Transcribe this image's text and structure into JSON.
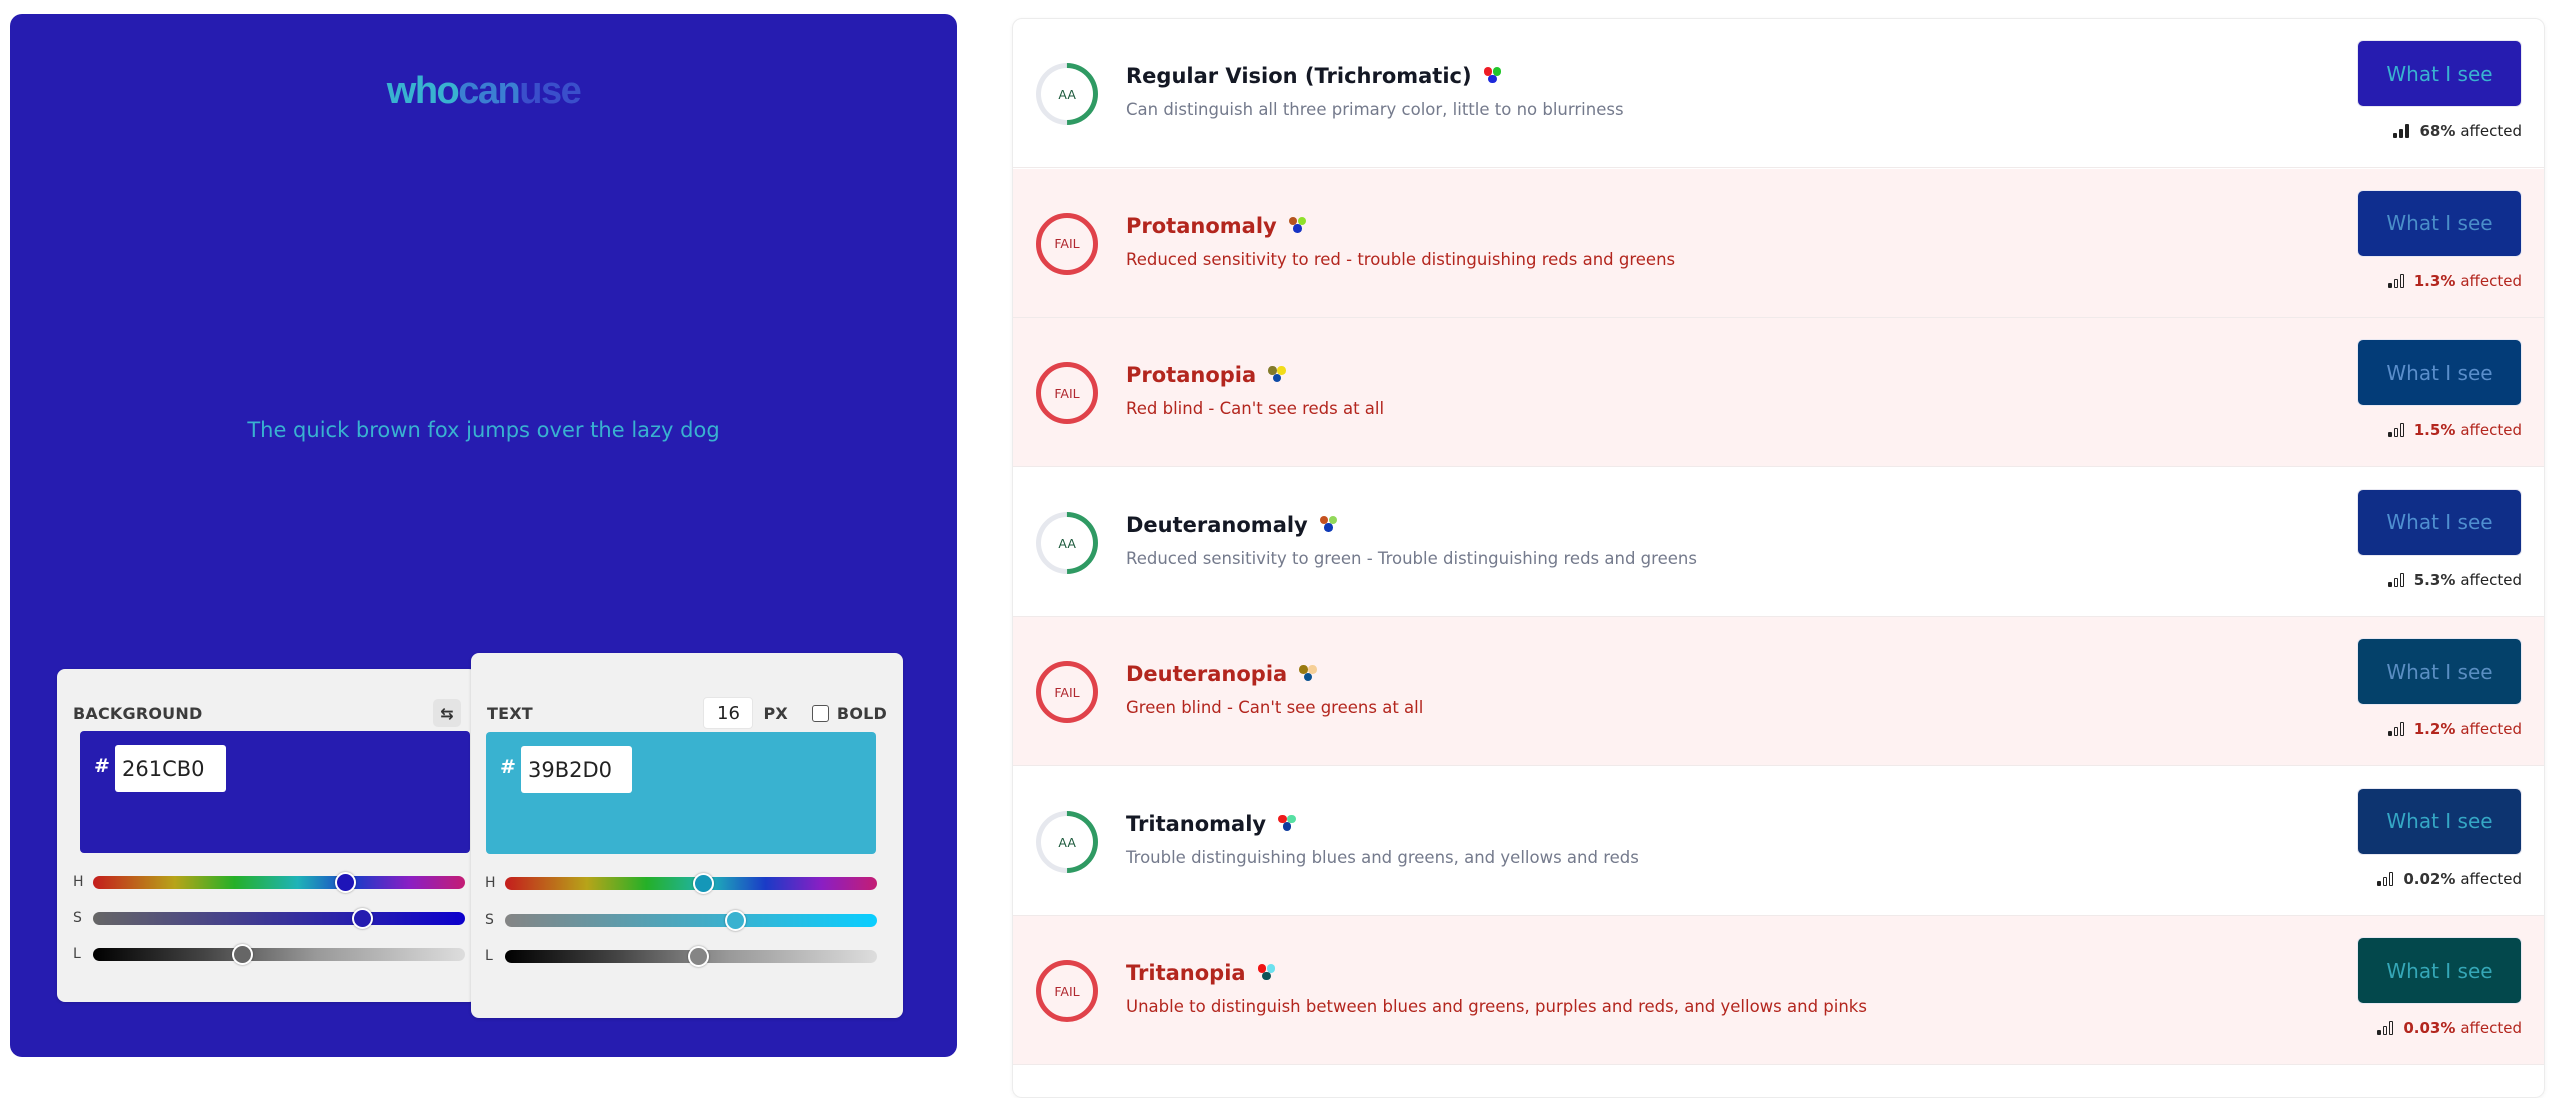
{
  "app": {
    "logo": {
      "part1": "who",
      "part2": "can",
      "part3": "use"
    }
  },
  "preview": {
    "sample_text": "The quick brown fox jumps over the lazy dog"
  },
  "background_picker": {
    "label": "BACKGROUND",
    "swap_icon": "⇆",
    "hash": "#",
    "hex": "261CB0",
    "color": "#261CB0",
    "h_label": "H",
    "s_label": "S",
    "l_label": "L",
    "hue": 243.6,
    "saturation": 72.3,
    "lightness": 40
  },
  "text_picker": {
    "label": "TEXT",
    "size": "16",
    "size_unit": "PX",
    "bold_label": "BOLD",
    "bold_checked": false,
    "hash": "#",
    "hex": "39B2D0",
    "color": "#39B2D0",
    "h_label": "H",
    "s_label": "S",
    "l_label": "L",
    "hue": 192,
    "saturation": 61.9,
    "lightness": 52
  },
  "vision_types": [
    {
      "rating": "AA",
      "status": "pass",
      "title": "Regular Vision (Trichromatic)",
      "description": "Can distinguish all three primary color, little to no blurriness",
      "button_label": "What I see",
      "button_bg": "#261CB0",
      "button_fg": "#39B2D0",
      "affected_pct": "68%",
      "affected_word": "affected",
      "signal_level": 3,
      "dots": [
        "#ee1c25",
        "#22c62b",
        "#1d29db"
      ]
    },
    {
      "rating": "FAIL",
      "status": "fail",
      "title": "Protanomaly",
      "description": "Reduced sensitivity to red - trouble distinguishing reds and greens",
      "button_label": "What I see",
      "button_bg": "#0f2e8f",
      "button_fg": "#4a8ec9",
      "affected_pct": "1.3%",
      "affected_word": "affected",
      "signal_level": 1,
      "dots": [
        "#b5541f",
        "#8fe12b",
        "#1733c4"
      ]
    },
    {
      "rating": "FAIL",
      "status": "fail",
      "title": "Protanopia",
      "description": "Red blind - Can't see reds at all",
      "button_label": "What I see",
      "button_bg": "#033c78",
      "button_fg": "#5a8ecb",
      "affected_pct": "1.5%",
      "affected_word": "affected",
      "signal_level": 1,
      "dots": [
        "#837b2a",
        "#f2dc1a",
        "#0f4ba6"
      ]
    },
    {
      "rating": "AA",
      "status": "pass",
      "title": "Deuteranomaly",
      "description": "Reduced sensitivity to green - Trouble distinguishing reds and greens",
      "button_label": "What I see",
      "button_bg": "#0f2e88",
      "button_fg": "#4f8fd0",
      "affected_pct": "5.3%",
      "affected_word": "affected",
      "signal_level": 1,
      "dots": [
        "#c55220",
        "#92d85a",
        "#0f3ab7"
      ]
    },
    {
      "rating": "FAIL",
      "status": "fail",
      "title": "Deuteranopia",
      "description": "Green blind - Can't see greens at all",
      "button_label": "What I see",
      "button_bg": "#04416a",
      "button_fg": "#5a8ec2",
      "affected_pct": "1.2%",
      "affected_word": "affected",
      "signal_level": 1,
      "dots": [
        "#9a7a10",
        "#f6cf96",
        "#0b5391"
      ]
    },
    {
      "rating": "AA",
      "status": "pass",
      "title": "Tritanomaly",
      "description": "Trouble distinguishing blues and greens, and yellows and reds",
      "button_label": "What I see",
      "button_bg": "#0d3470",
      "button_fg": "#35a7c5",
      "affected_pct": "0.02%",
      "affected_word": "affected",
      "signal_level": 1,
      "dots": [
        "#ee1c1c",
        "#57e0a3",
        "#0e3b9e"
      ]
    },
    {
      "rating": "FAIL",
      "status": "fail",
      "title": "Tritanopia",
      "description": "Unable to distinguish between blues and greens, purples and reds, and yellows and pinks",
      "button_label": "What I see",
      "button_bg": "#03484c",
      "button_fg": "#35a7b7",
      "affected_pct": "0.03%",
      "affected_word": "affected",
      "signal_level": 1,
      "dots": [
        "#ee1515",
        "#6ce1ef",
        "#0d5458"
      ]
    }
  ]
}
